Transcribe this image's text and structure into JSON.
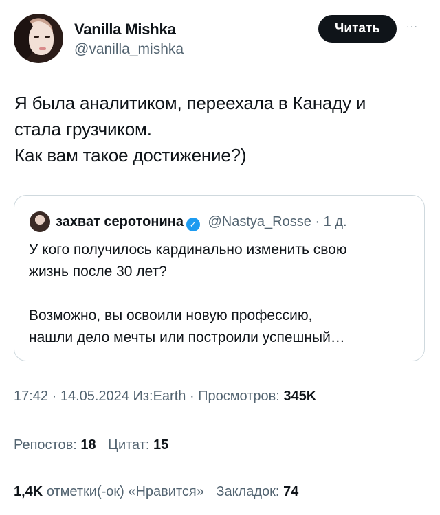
{
  "author": {
    "display_name": "Vanilla Mishka",
    "handle": "@vanilla_mishka"
  },
  "follow_button": "Читать",
  "more_icon": "···",
  "tweet_lines": [
    "Я была аналитиком, переехала в Канаду и",
    "стала грузчиком.",
    "Как вам такое достижение?)"
  ],
  "quote": {
    "name": "захват серотонина",
    "verified_glyph": "✓",
    "handle": "@Nastya_Rosse",
    "separator": "·",
    "time": "1 д.",
    "body_para1": [
      "У кого получилось кардинально изменить свою",
      "жизнь после 30 лет?"
    ],
    "body_para2": [
      "Возможно, вы освоили новую профессию,",
      "нашли дело мечты или построили успешный…"
    ]
  },
  "meta": {
    "text": "17:42 · 14.05.2024 Из:Earth · Просмотров: ",
    "views": "345K"
  },
  "stats1": {
    "reposts_label": "Репостов:",
    "reposts": "18",
    "quotes_label": "Цитат:",
    "quotes": "15"
  },
  "stats2": {
    "likes": "1,4K",
    "likes_label": "отметки(-ок) «Нравится»",
    "bookmarks_label": "Закладок:",
    "bookmarks": "74"
  },
  "colors": {
    "text": "#0f1419",
    "secondary": "#536471",
    "verified": "#1d9bf0",
    "border": "#cfd9de"
  }
}
